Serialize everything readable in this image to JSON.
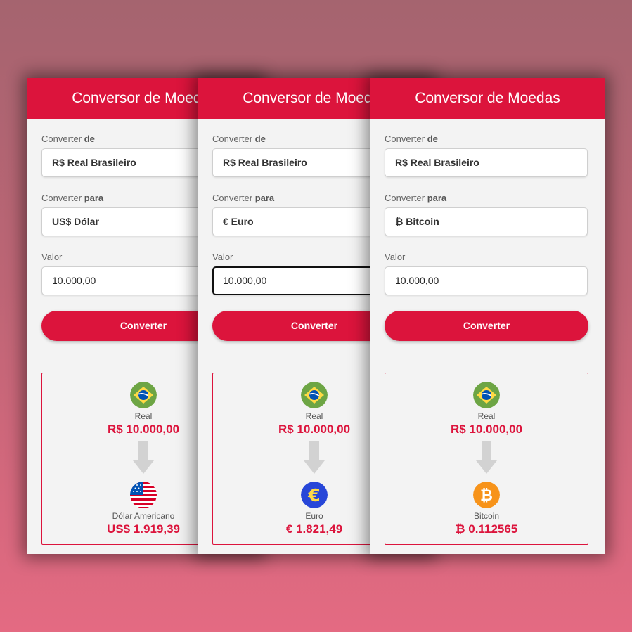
{
  "cards": [
    {
      "title": "Conversor de Moedas",
      "from_label_prefix": "Converter",
      "from_label_bold": "de",
      "from_value": "R$ Real Brasileiro",
      "to_label_prefix": "Converter",
      "to_label_bold": "para",
      "to_value": "US$ Dólar",
      "amount_label": "Valor",
      "amount_value": "10.000,00",
      "button_label": "Converter",
      "result": {
        "from_icon": "brazil-flag-icon",
        "from_name": "Real",
        "from_amount": "R$ 10.000,00",
        "to_icon": "usa-flag-icon",
        "to_name": "Dólar Americano",
        "to_amount": "US$ 1.919,39"
      }
    },
    {
      "title": "Conversor de Moedas",
      "from_label_prefix": "Converter",
      "from_label_bold": "de",
      "from_value": "R$ Real Brasileiro",
      "to_label_prefix": "Converter",
      "to_label_bold": "para",
      "to_value": "€ Euro",
      "amount_label": "Valor",
      "amount_value": "10.000,00",
      "button_label": "Converter",
      "result": {
        "from_icon": "brazil-flag-icon",
        "from_name": "Real",
        "from_amount": "R$ 10.000,00",
        "to_icon": "euro-icon",
        "to_name": "Euro",
        "to_amount": "€ 1.821,49"
      }
    },
    {
      "title": "Conversor de Moedas",
      "from_label_prefix": "Converter",
      "from_label_bold": "de",
      "from_value": "R$ Real Brasileiro",
      "to_label_prefix": "Converter",
      "to_label_bold": "para",
      "to_value": "₿ Bitcoin",
      "amount_label": "Valor",
      "amount_value": "10.000,00",
      "button_label": "Converter",
      "result": {
        "from_icon": "brazil-flag-icon",
        "from_name": "Real",
        "from_amount": "R$ 10.000,00",
        "to_icon": "bitcoin-icon",
        "to_name": "Bitcoin",
        "to_amount": "₿ 0.112565"
      }
    }
  ],
  "colors": {
    "accent": "#dc143c",
    "background_top": "#a5646f",
    "background_bottom": "#e46a82",
    "card": "#f3f3f3"
  }
}
